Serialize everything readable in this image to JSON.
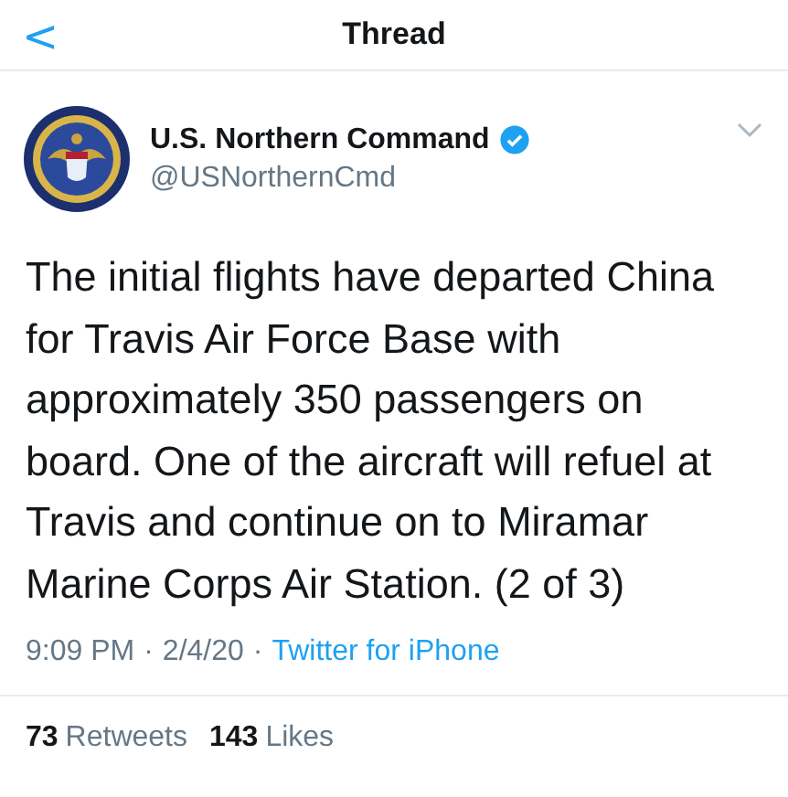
{
  "header": {
    "back": "<",
    "title": "Thread"
  },
  "author": {
    "name": "U.S. Northern Command",
    "verified": true,
    "handle": "@USNorthernCmd"
  },
  "tweet": {
    "text": "The initial flights have departed China for Travis Air Force Base with approximately 350 passengers on board. One of the aircraft will refuel at Travis and continue on to Miramar Marine Corps Air Station. (2 of 3)"
  },
  "meta": {
    "time": "9:09 PM",
    "separator_1": "·",
    "date": "2/4/20",
    "separator_2": "·",
    "source": "Twitter for iPhone"
  },
  "stats": [
    {
      "count": "73",
      "label": "Retweets"
    },
    {
      "count": "143",
      "label": "Likes"
    }
  ]
}
